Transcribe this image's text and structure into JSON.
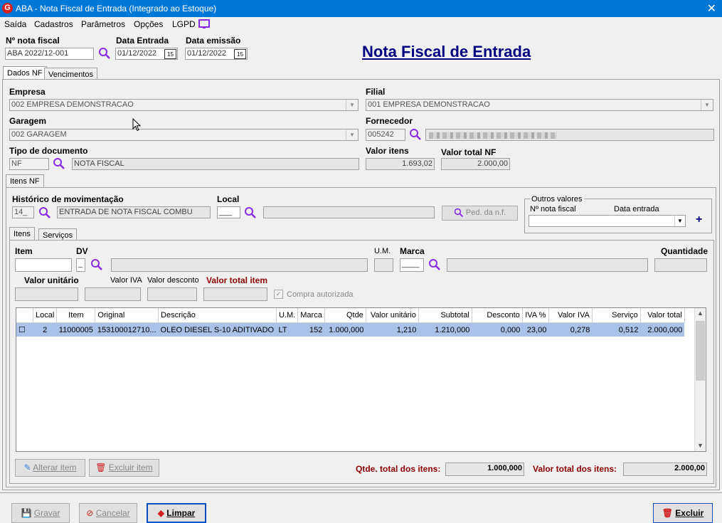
{
  "window": {
    "title": "ABA - Nota Fiscal de Entrada (Integrado ao Estoque)"
  },
  "menu": [
    "Saída",
    "Cadastros",
    "Parâmetros",
    "Opções",
    "LGPD"
  ],
  "header": {
    "nota_label": "Nº nota fiscal",
    "nota_value": "ABA 2022/12-001",
    "data_entrada_label": "Data Entrada",
    "data_entrada_value": "01/12/2022",
    "data_emissao_label": "Data emissão",
    "data_emissao_value": "01/12/2022",
    "page_title": "Nota Fiscal de Entrada"
  },
  "tabs": {
    "dados_nf": "Dados NF",
    "vencimentos": "Vencimentos",
    "itens_nf": "Itens NF",
    "itens": "Itens",
    "servicos": "Serviços"
  },
  "dados": {
    "empresa_label": "Empresa",
    "empresa_value": "002 EMPRESA DEMONSTRACAO",
    "filial_label": "Filial",
    "filial_value": "001 EMPRESA DEMONSTRACAO",
    "garagem_label": "Garagem",
    "garagem_value": "002 GARAGEM",
    "fornecedor_label": "Fornecedor",
    "fornecedor_code": "005242",
    "tipo_label": "Tipo de documento",
    "tipo_code": "NF",
    "tipo_desc": "NOTA FISCAL",
    "valor_itens_label": "Valor itens",
    "valor_itens_value": "1.693,02",
    "valor_total_label": "Valor total NF",
    "valor_total_value": "2.000,00"
  },
  "itens_nf": {
    "historico_label": "Histórico de movimentação",
    "historico_code": "14_",
    "historico_desc": "ENTRADA DE NOTA FISCAL COMBU",
    "local_label": "Local",
    "local_code": "___",
    "ped_button": "Ped. da n.f.",
    "outros_label": "Outros valores",
    "outros_nota_label": "Nº nota fiscal",
    "outros_data_label": "Data entrada"
  },
  "item_form": {
    "item_label": "Item",
    "dv_label": "DV",
    "dv_value": "_",
    "um_label": "U.M.",
    "marca_label": "Marca",
    "marca_value": "____",
    "quantidade_label": "Quantidade",
    "valor_unitario_label": "Valor unitário",
    "valor_iva_label": "Valor IVA",
    "valor_desconto_label": "Valor desconto",
    "valor_total_item_label": "Valor total item",
    "compra_label": "Compra autorizada"
  },
  "table": {
    "columns": [
      "",
      "Local",
      "Item",
      "Original",
      "Descrição",
      "U.M.",
      "Marca",
      "Qtde",
      "Valor unitário",
      "Subtotal",
      "Desconto",
      "IVA %",
      "Valor IVA",
      "Serviço",
      "Valor total"
    ],
    "rows": [
      [
        "☐",
        "2",
        "11000005",
        "153100012710...",
        "OLEO DIESEL S-10  ADITIVADO",
        "LT",
        "152",
        "1.000,000",
        "1,210",
        "1.210,000",
        "0,000",
        "23,00",
        "0,278",
        "0,512",
        "2.000,000"
      ]
    ]
  },
  "bottom": {
    "alterar": "Alterar item",
    "excluir_item": "Excluir item",
    "qtde_total_label": "Qtde. total dos itens:",
    "qtde_total_value": "1.000,000",
    "valor_total_label": "Valor total dos itens:",
    "valor_total_value": "2.000,00"
  },
  "footer": {
    "gravar": "Gravar",
    "cancelar": "Cancelar",
    "limpar": "Limpar",
    "excluir": "Excluir"
  },
  "colors": {
    "title_blue": "#0078d7",
    "heading_blue": "#000080",
    "magnifier": "#8a2be2",
    "selection": "#a9c2e8",
    "dark_red": "#8b0000"
  }
}
